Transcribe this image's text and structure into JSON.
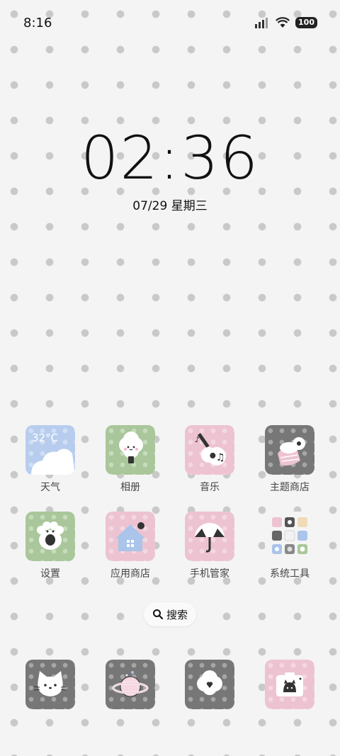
{
  "status_bar": {
    "time": "8:16",
    "battery": "100"
  },
  "clock": {
    "time": "02:36",
    "date": "07/29 星期三"
  },
  "weather": {
    "temp": "32°C"
  },
  "apps_row1": [
    {
      "label": "天气"
    },
    {
      "label": "相册"
    },
    {
      "label": "音乐"
    },
    {
      "label": "主题商店"
    }
  ],
  "apps_row2": [
    {
      "label": "设置"
    },
    {
      "label": "应用商店"
    },
    {
      "label": "手机管家"
    },
    {
      "label": "系统工具"
    }
  ],
  "search": {
    "label": "搜索"
  },
  "colors": {
    "green": "#a9c79a",
    "pink": "#edc3d2",
    "gray": "#777777",
    "blue": "#b8cdee"
  }
}
